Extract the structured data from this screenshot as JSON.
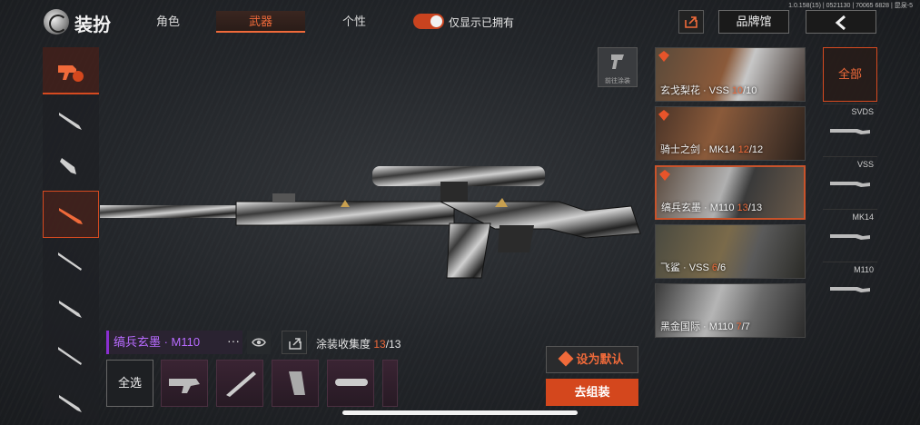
{
  "version": "1.0.158(15) | 0521130 | 70065 6828 | 昆泉-5",
  "header": {
    "title": "装扮",
    "tabs": [
      {
        "label": "角色",
        "active": false
      },
      {
        "label": "武器",
        "active": true
      },
      {
        "label": "个性",
        "active": false
      }
    ],
    "toggle_label": "仅显示已拥有",
    "toggle_on": true,
    "brand_label": "品牌馆"
  },
  "left_categories": [
    "preset-icon",
    "assault-rifle-icon",
    "smg-icon",
    "sniper-rifle-icon",
    "shotgun-icon",
    "rifle-icon",
    "marksman-icon",
    "lmg-icon"
  ],
  "go_paint_label": "前往涂装",
  "skin": {
    "name": "缟兵玄墨 · M110",
    "more": "···",
    "collect_label": "涂装收集度",
    "collect_current": "13",
    "collect_total": "/13"
  },
  "select_all_label": "全选",
  "set_default_label": "设为默认",
  "assemble_label": "去组装",
  "cards": [
    {
      "name": "玄戈梨花 · VSS ",
      "cur": "10",
      "total": "/10"
    },
    {
      "name": "骑士之剑 · MK14 ",
      "cur": "12",
      "total": "/12"
    },
    {
      "name": "缟兵玄墨 · M110 ",
      "cur": "13",
      "total": "/13"
    },
    {
      "name": "飞鲨 · VSS ",
      "cur": "6",
      "total": "/6"
    },
    {
      "name": "黑金国际 · M110 ",
      "cur": "7",
      "total": "/7"
    }
  ],
  "filter": {
    "all_label": "全部",
    "items": [
      "SVDS",
      "VSS",
      "MK14",
      "M110"
    ]
  },
  "colors": {
    "accent": "#f06a3a",
    "purple": "#b86bff"
  }
}
